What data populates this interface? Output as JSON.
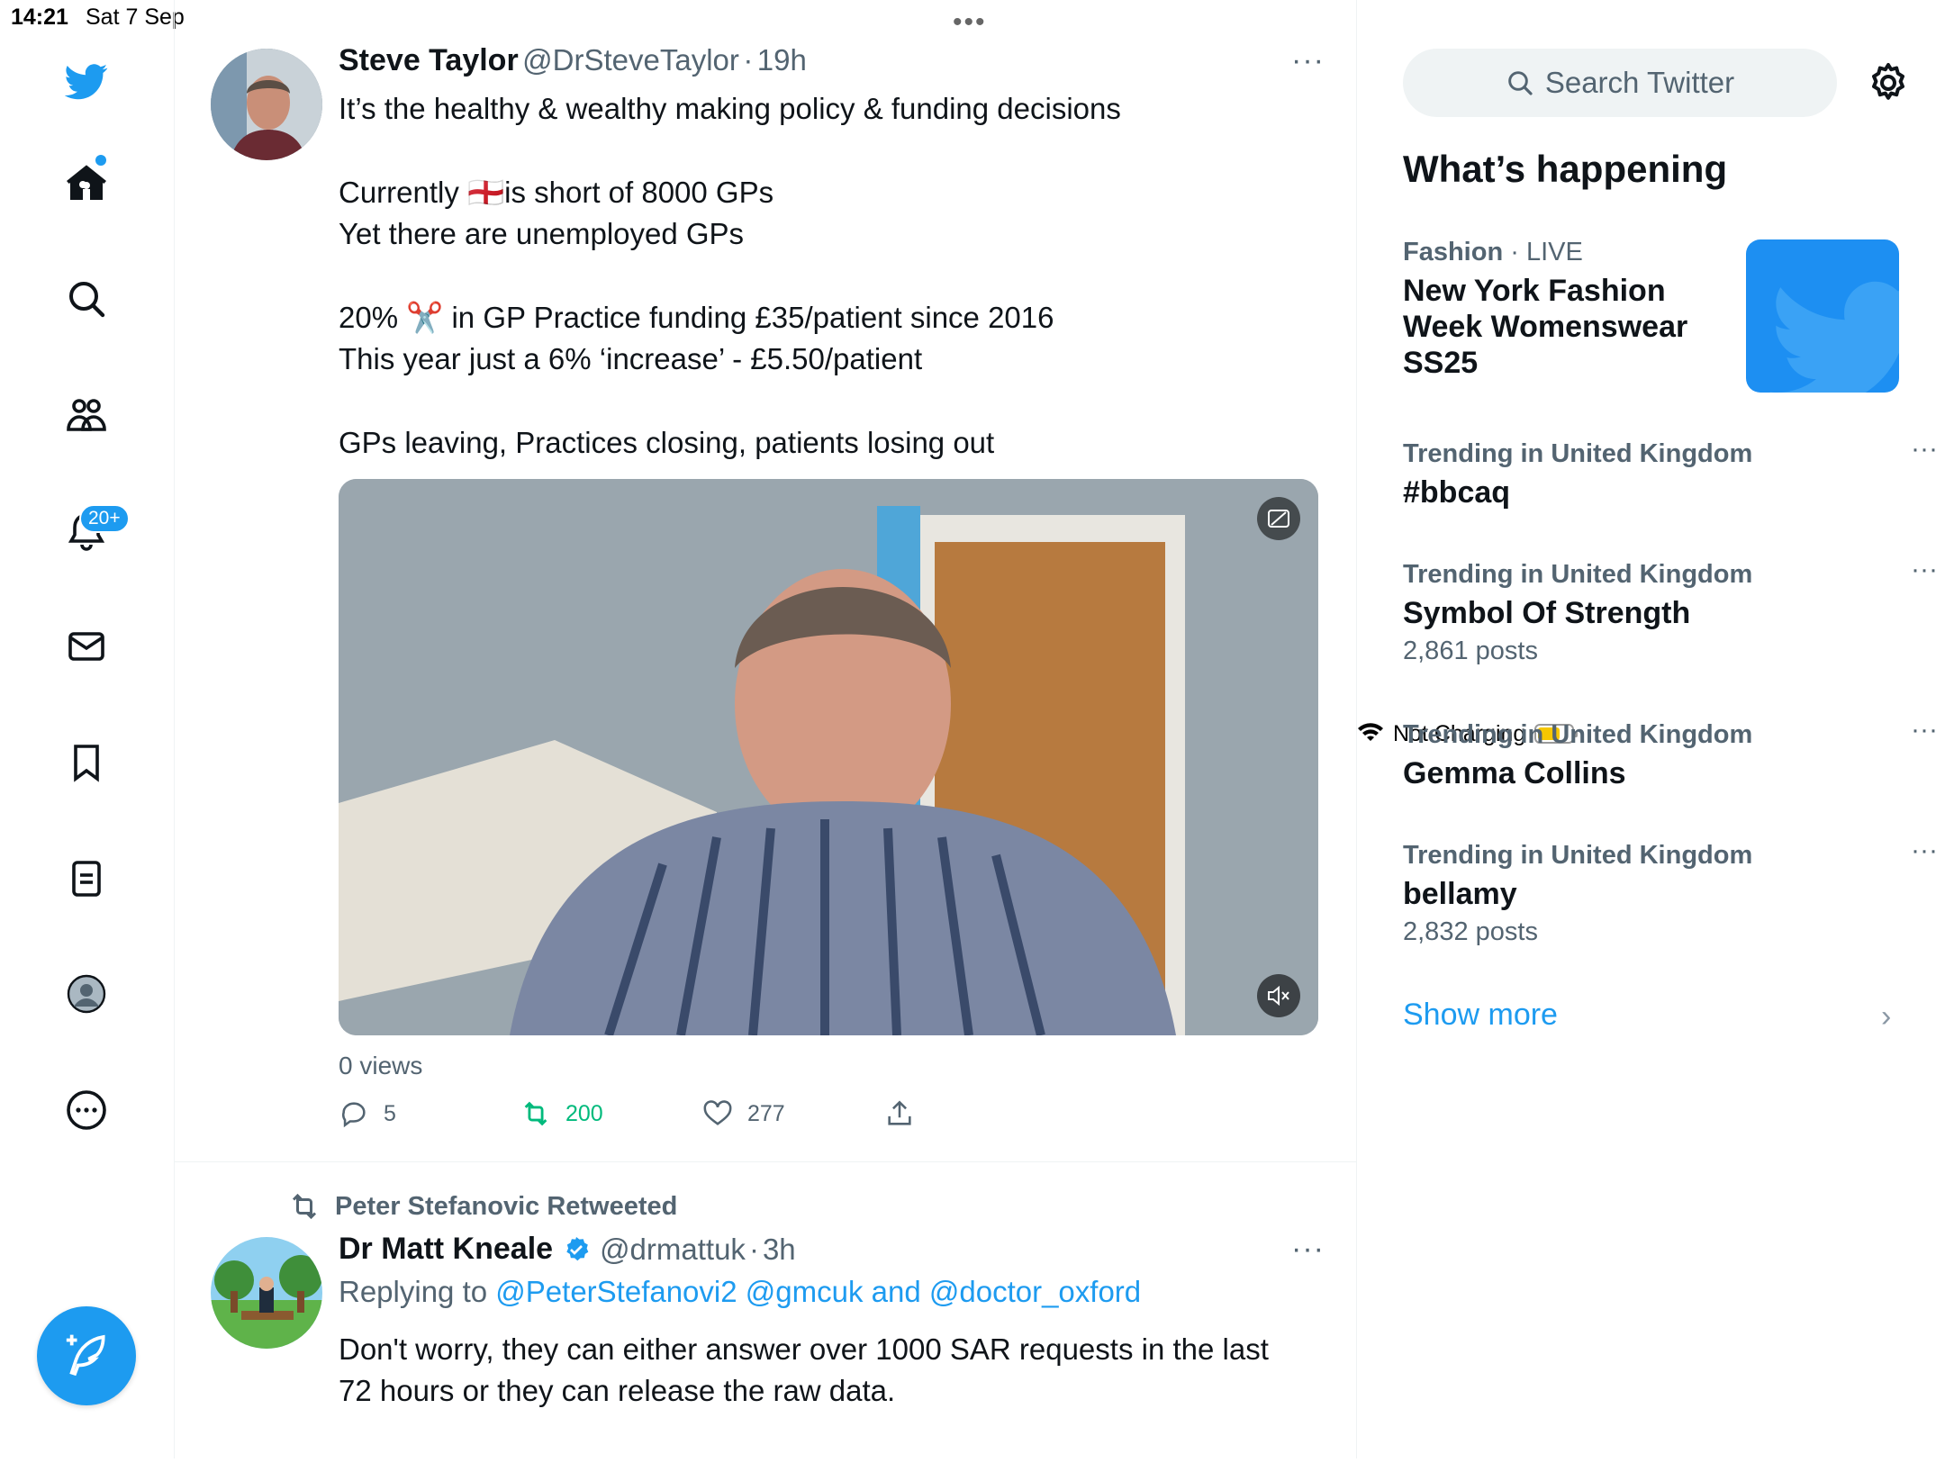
{
  "status_bar": {
    "time": "14:21",
    "date": "Sat 7 Sep",
    "charging": "Not Charging",
    "battery_level": 0.55
  },
  "sidebar": {
    "items": [
      {
        "name": "twitter-logo-icon"
      },
      {
        "name": "home-icon"
      },
      {
        "name": "search-icon"
      },
      {
        "name": "communities-icon"
      },
      {
        "name": "notifications-icon"
      },
      {
        "name": "messages-icon"
      },
      {
        "name": "bookmarks-icon"
      },
      {
        "name": "lists-icon"
      },
      {
        "name": "profile-icon"
      },
      {
        "name": "more-icon"
      }
    ],
    "notifications_badge": "20+",
    "accent": "#1d9bf0"
  },
  "tweet1": {
    "name": "Steve Taylor",
    "handle": "@DrSteveTaylor",
    "sep": "·",
    "time": "19h",
    "lines": [
      "It’s the healthy & wealthy making policy & funding decisions",
      "Currently 🏴󠁧󠁢󠁥󠁮󠁧󠁿is short of 8000 GPs",
      "Yet there are unemployed GPs",
      "20% ✂️ in GP Practice funding £35/patient since 2016",
      "This year just a 6% ‘increase’ - £5.50/patient",
      "GPs leaving, Practices closing, patients losing out"
    ],
    "views": "0 views",
    "replies": "5",
    "retweets": "200",
    "likes": "277",
    "retweet_color": "#00ba7c"
  },
  "tweet2": {
    "retweeted_by": "Peter Stefanovic Retweeted",
    "name": "Dr Matt Kneale",
    "handle": "@drmattuk",
    "sep": "·",
    "time": "3h",
    "replying_to_label": "Replying to",
    "replying_to": "@PeterStefanovi2 @gmcuk and @doctor_oxford",
    "text_line1": "Don't worry, they can either answer over 1000 SAR requests in the last",
    "text_line2": "72 hours or they can release the raw data."
  },
  "right": {
    "search_placeholder": "Search Twitter",
    "whats_happening": "What’s happening",
    "trends": [
      {
        "category": "Fashion",
        "live": "· LIVE",
        "title_l1": "New York Fashion",
        "title_l2": "Week Womenswear",
        "title_l3": "SS25"
      },
      {
        "category": "Trending in United Kingdom",
        "title": "#bbcaq",
        "count": ""
      },
      {
        "category": "Trending in United Kingdom",
        "title": "Symbol Of Strength",
        "count": "2,861 posts"
      },
      {
        "category": "Trending in United Kingdom",
        "title": "Gemma Collins",
        "count": ""
      },
      {
        "category": "Trending in United Kingdom",
        "title": "bellamy",
        "count": "2,832 posts"
      }
    ],
    "show_more": "Show more"
  }
}
